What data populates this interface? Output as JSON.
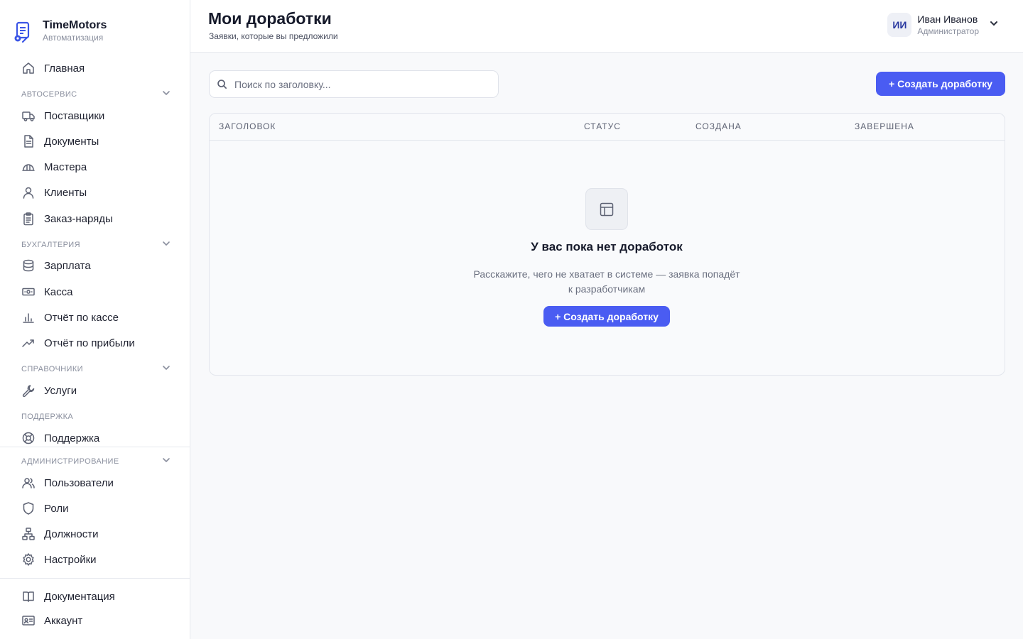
{
  "brand": {
    "name": "TimeMotors",
    "subtitle": "Автоматизация"
  },
  "nav": {
    "home": "Главная",
    "autoservice": {
      "title": "АВТОСЕРВИС",
      "items": [
        "Поставщики",
        "Документы",
        "Мастера",
        "Клиенты",
        "Заказ-наряды"
      ]
    },
    "accounting": {
      "title": "БУХГАЛТЕРИЯ",
      "items": [
        "Зарплата",
        "Касса",
        "Отчёт по кассе",
        "Отчёт по прибыли"
      ]
    },
    "references": {
      "title": "СПРАВОЧНИКИ",
      "items": [
        "Услуги"
      ]
    },
    "support": {
      "title": "ПОДДЕРЖКА",
      "items": [
        "Поддержка"
      ]
    },
    "admin": {
      "title": "АДМИНИСТРИРОВАНИЕ",
      "items": [
        "Пользователи",
        "Роли",
        "Должности",
        "Настройки"
      ]
    },
    "footer": [
      "Документация",
      "Аккаунт"
    ]
  },
  "header": {
    "title": "Мои доработки",
    "subtitle": "Заявки, которые вы предложили",
    "user": {
      "initials": "ИИ",
      "name": "Иван Иванов",
      "role": "Администратор"
    }
  },
  "toolbar": {
    "search_placeholder": "Поиск по заголовку...",
    "create_label": "+ Создать доработку"
  },
  "table": {
    "columns": [
      "ЗАГОЛОВОК",
      "СТАТУС",
      "СОЗДАНА",
      "ЗАВЕРШЕНА"
    ],
    "rows": []
  },
  "empty_state": {
    "title": "У вас пока нет доработок",
    "text": "Расскажите, чего не хватает в системе — заявка попадёт к разработчикам",
    "button_label": "+ Создать доработку"
  },
  "colors": {
    "accent": "#4a5cf2",
    "background": "#f8f9fb"
  }
}
